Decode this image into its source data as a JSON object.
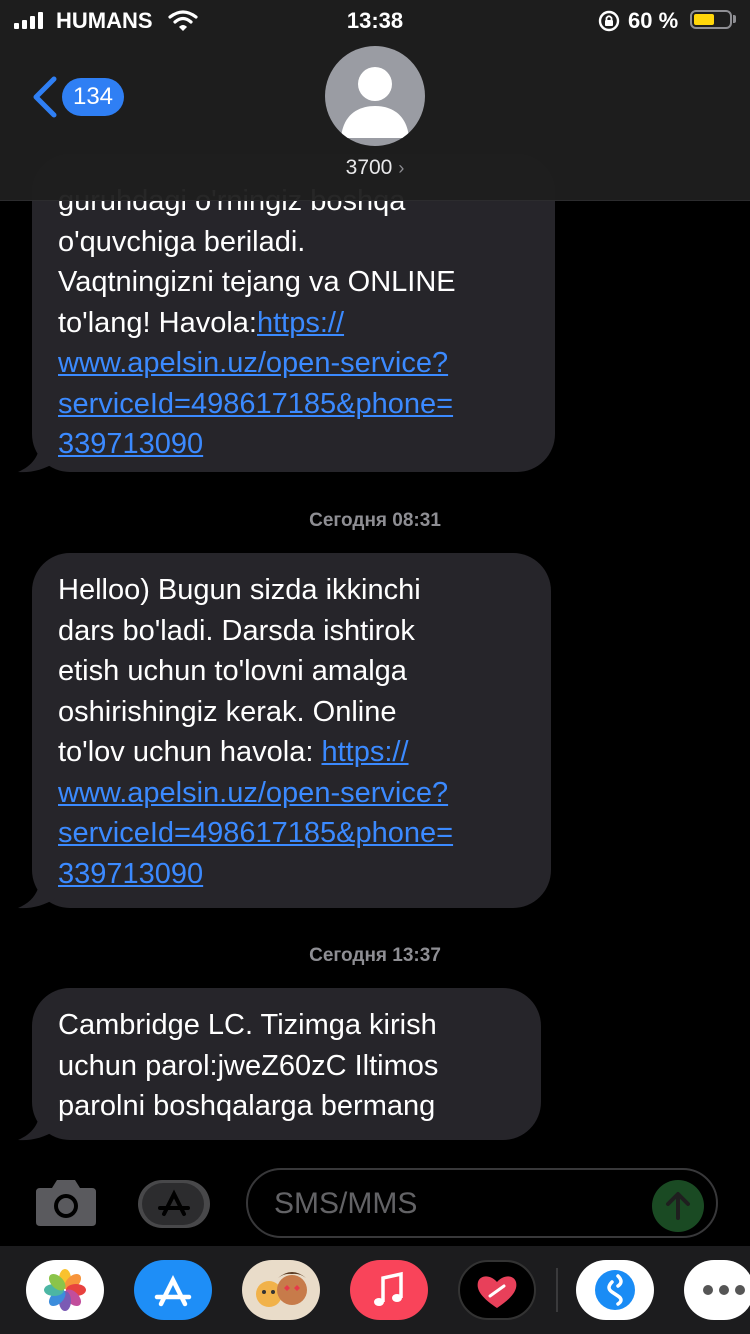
{
  "status_bar": {
    "carrier": "HUMANS",
    "time": "13:38",
    "battery_percent": "60 %",
    "battery_level": 0.6
  },
  "header": {
    "back_count": "134",
    "contact": "3700",
    "contact_chevron": "›"
  },
  "messages": [
    {
      "lines": [
        "guruhdagi o'rningiz boshqa",
        "o'quvchiga beriladi.",
        "Vaqtningizni tejang va ONLINE",
        "to'lang! Havola:"
      ],
      "link_lines": [
        "https://",
        "www.apelsin.uz/open-service?",
        "serviceId=498617185&phone=",
        "339713090"
      ]
    },
    {
      "timestamp": "Сегодня 08:31",
      "lines": [
        "Helloo) Bugun sizda ikkinchi",
        "dars bo'ladi. Darsda ishtirok",
        "etish uchun to'lovni amalga",
        "oshirishingiz kerak. Online",
        "to'lov uchun havola: "
      ],
      "link_lines": [
        "https://",
        "www.apelsin.uz/open-service?",
        "serviceId=498617185&phone=",
        "339713090"
      ]
    },
    {
      "timestamp": "Сегодня 13:37",
      "lines": [
        "Cambridge LC. Tizimga kirish",
        "uchun parol:jweZ60zC Iltimos",
        "parolni boshqalarga bermang"
      ]
    }
  ],
  "input": {
    "placeholder": "SMS/MMS"
  },
  "app_drawer": {
    "apps": [
      "photos-app-icon",
      "app-store-app-icon",
      "memoji-app-icon",
      "music-app-icon",
      "digital-touch-app-icon",
      "shazam-app-icon",
      "more-apps-icon"
    ]
  },
  "colors": {
    "bubble": "#26252a",
    "link": "#3b8aff",
    "accent": "#2f7ff4",
    "battery": "#ffd60a"
  }
}
